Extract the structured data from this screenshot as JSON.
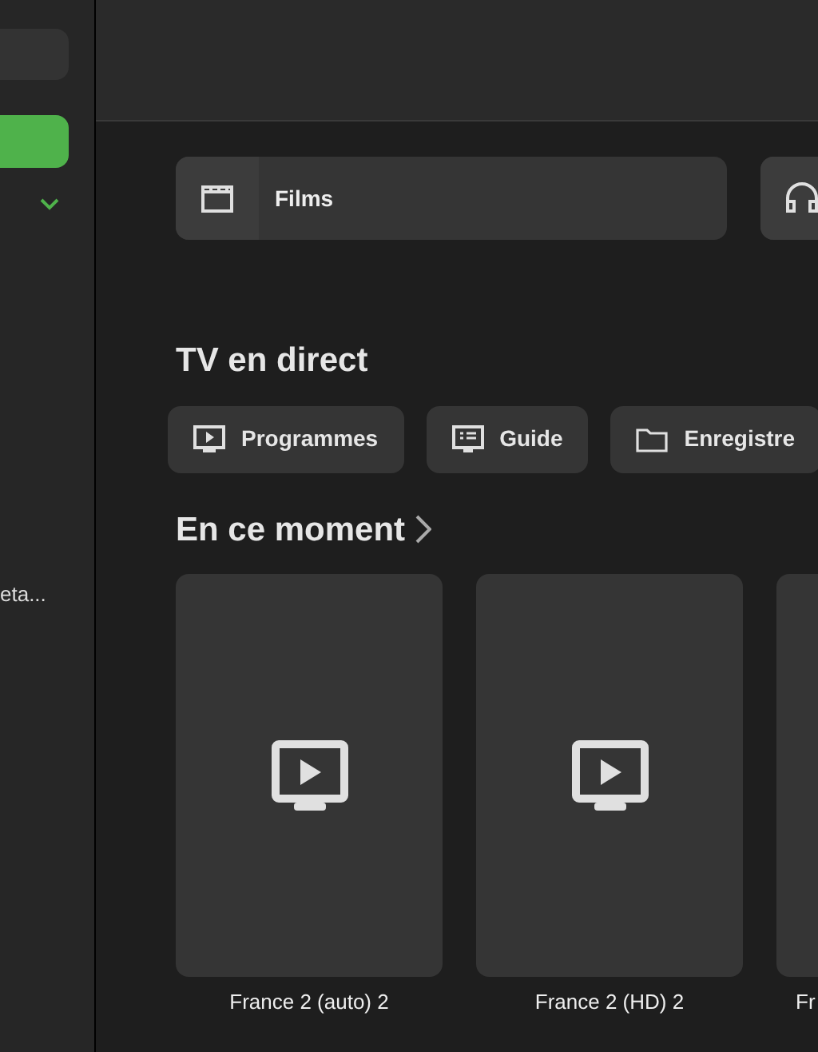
{
  "sidebar": {
    "items": [
      {
        "kind": "field"
      },
      {
        "kind": "button",
        "selected": true
      },
      {
        "kind": "chevron",
        "expanded": false
      },
      {
        "kind": "text",
        "label": "eta..."
      }
    ]
  },
  "shortcuts": [
    {
      "kind": "films",
      "label": "Films"
    },
    {
      "kind": "music"
    }
  ],
  "live_tv": {
    "title": "TV en direct",
    "buttons": [
      {
        "kind": "programmes",
        "label": "Programmes"
      },
      {
        "kind": "guide",
        "label": "Guide"
      },
      {
        "kind": "recordings",
        "label": "Enregistre"
      }
    ]
  },
  "now": {
    "title": "En ce moment",
    "channels": [
      {
        "kind": "full",
        "label": "France 2 (auto) 2"
      },
      {
        "kind": "full",
        "label": "France 2 (HD) 2"
      },
      {
        "kind": "clipped",
        "label": "Fr"
      }
    ]
  }
}
